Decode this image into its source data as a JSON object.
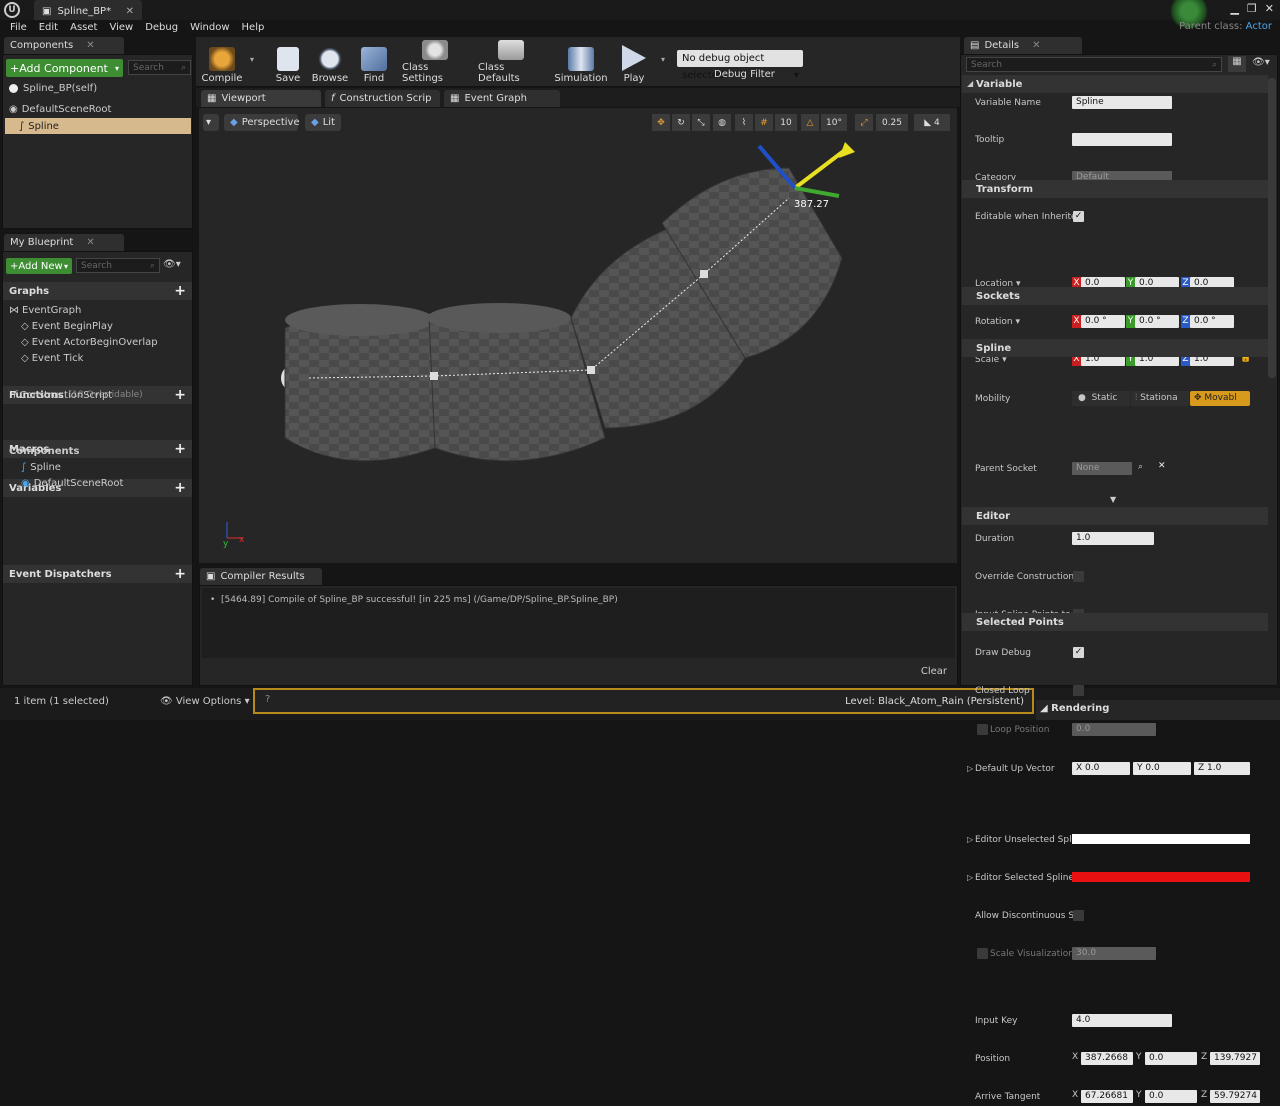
{
  "window": {
    "tab_title": "Spline_BP*",
    "parent_class_label": "Parent class:",
    "parent_class_value": "Actor"
  },
  "menu": [
    "File",
    "Edit",
    "Asset",
    "View",
    "Debug",
    "Window",
    "Help"
  ],
  "components_panel": {
    "tab": "Components",
    "add_component": "+Add Component",
    "search_placeholder": "Search",
    "self_item": "Spline_BP(self)",
    "root_item": "DefaultSceneRoot",
    "child_item": "Spline"
  },
  "my_blueprint": {
    "tab": "My Blueprint",
    "add_new": "+Add New",
    "search_placeholder": "Search",
    "graphs_label": "Graphs",
    "event_graph": "EventGraph",
    "events": [
      "Event BeginPlay",
      "Event ActorBeginOverlap",
      "Event Tick"
    ],
    "functions_label": "Functions",
    "functions_count": "(18 Overridable)",
    "construction_script": "ConstructionScript",
    "macros_label": "Macros",
    "variables_label": "Variables",
    "components_label": "Components",
    "component_items": [
      "Spline",
      "DefaultSceneRoot"
    ],
    "dispatchers_label": "Event Dispatchers"
  },
  "toolbar": {
    "compile": "Compile",
    "save": "Save",
    "browse": "Browse",
    "find": "Find",
    "class_settings": "Class Settings",
    "class_defaults": "Class Defaults",
    "simulation": "Simulation",
    "play": "Play",
    "debug_select": "No debug object selected",
    "debug_filter": "Debug Filter"
  },
  "editor_tabs": [
    "Viewport",
    "Construction Scrip",
    "Event Graph"
  ],
  "viewport": {
    "perspective": "Perspective",
    "lit": "Lit",
    "grid_snap": "10",
    "rot_snap": "10°",
    "scale_snap": "0.25",
    "cam_speed": "4",
    "gizmo_readout": "387.27"
  },
  "compiler": {
    "tab": "Compiler Results",
    "message": "[5464.89] Compile of Spline_BP successful! [in 225 ms] (/Game/DP/Spline_BP.Spline_BP)",
    "clear": "Clear"
  },
  "status": {
    "selection": "1 item (1 selected)",
    "view_options": "View Options",
    "level": "Level:  Black_Atom_Rain (Persistent)"
  },
  "details": {
    "tab": "Details",
    "search_placeholder": "Search",
    "variable": {
      "header": "Variable",
      "name_label": "Variable Name",
      "name_value": "Spline",
      "tooltip_label": "Tooltip",
      "category_label": "Category",
      "category_value": "Default",
      "editable_label": "Editable when Inherited"
    },
    "transform": {
      "header": "Transform",
      "location": "Location",
      "rotation": "Rotation",
      "scale": "Scale",
      "mobility": "Mobility",
      "loc": [
        "0.0",
        "0.0",
        "0.0"
      ],
      "rot": [
        "0.0 °",
        "0.0 °",
        "0.0 °"
      ],
      "scl": [
        "1.0",
        "1.0",
        "1.0"
      ],
      "static": "Static",
      "stationary": "Stationa",
      "movable": "Movabl"
    },
    "sockets": {
      "header": "Sockets",
      "parent_socket": "Parent Socket",
      "value": "None"
    },
    "spline": {
      "header": "Spline",
      "duration": "Duration",
      "duration_value": "1.0",
      "override": "Override Construction S",
      "input_points": "Input Spline Points to C",
      "draw_debug": "Draw Debug",
      "closed_loop": "Closed Loop",
      "loop_position": "Loop Position",
      "loop_value": "0.0",
      "up_vector": "Default Up Vector",
      "up": [
        "0.0",
        "0.0",
        "1.0"
      ]
    },
    "editor": {
      "header": "Editor",
      "unselected": "Editor Unselected Splin",
      "selected": "Editor Selected Spline",
      "discontinuous": "Allow Discontinuous Sp",
      "scale_vis": "Scale Visualization",
      "scale_vis_value": "30.0"
    },
    "selected_points": {
      "header": "Selected Points",
      "input_key": "Input Key",
      "input_key_value": "4.0",
      "position": "Position",
      "pos": [
        "387.2668",
        "0.0",
        "139.7927"
      ],
      "arrive": "Arrive Tangent",
      "arr": [
        "67.26681",
        "0.0",
        "59.79274"
      ]
    },
    "rendering": "Rendering"
  },
  "colors": {
    "unselected": "#ffffff",
    "selected": "#e81010",
    "accent_green": "#3d8e32",
    "movable_orange": "#d89a1c"
  }
}
